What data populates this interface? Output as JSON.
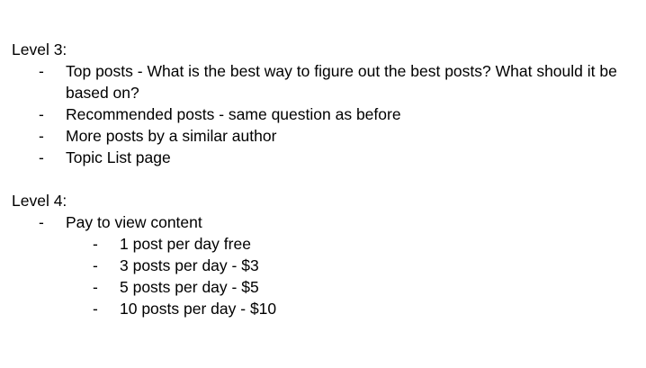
{
  "sections": [
    {
      "heading": "Level 3:",
      "items": [
        {
          "marker": "-",
          "text": "Top posts - What is the best way to figure out the best posts? What should it be based on?"
        },
        {
          "marker": "-",
          "text": "Recommended posts - same question as before"
        },
        {
          "marker": "-",
          "text": "More posts by a similar author"
        },
        {
          "marker": "-",
          "text": "Topic List page"
        }
      ]
    },
    {
      "heading": "Level 4:",
      "items": [
        {
          "marker": "-",
          "text": "Pay to view content"
        }
      ],
      "subitems": [
        {
          "marker": "-",
          "text": "1 post per day free"
        },
        {
          "marker": "-",
          "text": "3 posts per day - $3"
        },
        {
          "marker": "-",
          "text": "5 posts per day - $5"
        },
        {
          "marker": "-",
          "text": "10 posts per day - $10"
        }
      ]
    }
  ]
}
